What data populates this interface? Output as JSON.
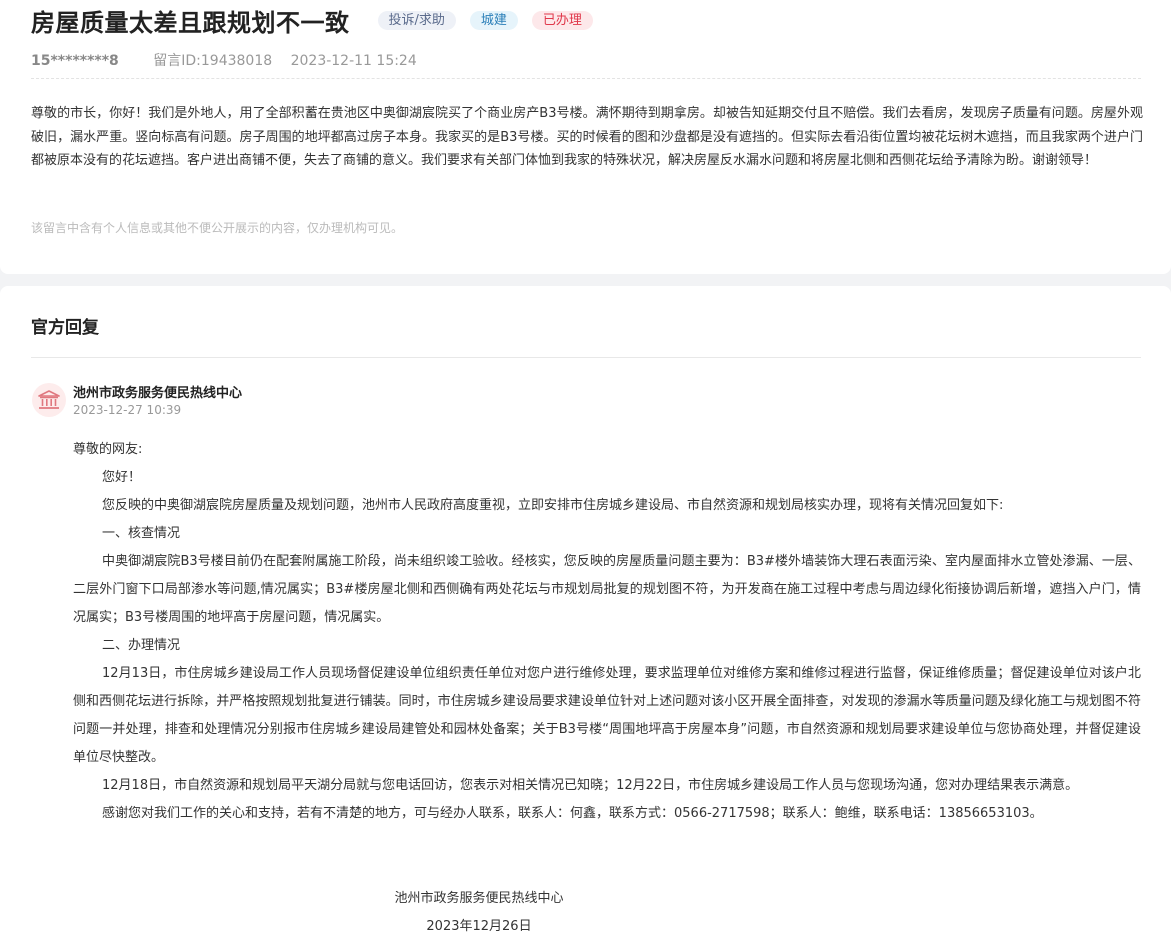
{
  "message": {
    "title": "房屋质量太差且跟规划不一致",
    "tags": {
      "type": "投诉/求助",
      "department": "城建",
      "status": "已办理"
    },
    "user_id": "15********8",
    "message_id_label": "留言ID:19438018",
    "datetime": "2023-12-11 15:24",
    "content": "尊敬的市长，你好！我们是外地人，用了全部积蓄在贵池区中奥御湖宸院买了个商业房产B3号楼。满怀期待到期拿房。却被告知延期交付且不赔偿。我们去看房，发现房子质量有问题。房屋外观破旧，漏水严重。竖向标高有问题。房子周围的地坪都高过房子本身。我家买的是B3号楼。买的时候看的图和沙盘都是没有遮挡的。但实际去看沿街位置均被花坛树木遮挡，而且我家两个进户门都被原本没有的花坛遮挡。客户进出商铺不便，失去了商铺的意义。我们要求有关部门体恤到我家的特殊状况，解决房屋反水漏水问题和将房屋北侧和西侧花坛给予清除为盼。谢谢领导！",
    "privacy_note": "该留言中含有个人信息或其他不便公开展示的内容，仅办理机构可见。"
  },
  "reply": {
    "heading": "官方回复",
    "avatar_icon": "government-building-icon",
    "org_name": "池州市政务服务便民热线中心",
    "datetime": "2023-12-27 10:39",
    "greeting": "尊敬的网友:",
    "paragraphs": [
      "您好！",
      "您反映的中奥御湖宸院房屋质量及规划问题，池州市人民政府高度重视，立即安排市住房城乡建设局、市自然资源和规划局核实办理，现将有关情况回复如下:",
      "一、核查情况",
      "中奥御湖宸院B3号楼目前仍在配套附属施工阶段，尚未组织竣工验收。经核实，您反映的房屋质量问题主要为：B3#楼外墙装饰大理石表面污染、室内屋面排水立管处渗漏、一层、二层外门窗下口局部渗水等问题,情况属实；B3#楼房屋北侧和西侧确有两处花坛与市规划局批复的规划图不符，为开发商在施工过程中考虑与周边绿化衔接协调后新增，遮挡入户门，情况属实；B3号楼周围的地坪高于房屋问题，情况属实。",
      "二、办理情况",
      "12月13日，市住房城乡建设局工作人员现场督促建设单位组织责任单位对您户进行维修处理，要求监理单位对维修方案和维修过程进行监督，保证维修质量；督促建设单位对该户北侧和西侧花坛进行拆除，并严格按照规划批复进行铺装。同时，市住房城乡建设局要求建设单位针对上述问题对该小区开展全面排查，对发现的渗漏水等质量问题及绿化施工与规划图不符问题一并处理，排查和处理情况分别报市住房城乡建设局建管处和园林处备案；关于B3号楼“周围地坪高于房屋本身”问题，市自然资源和规划局要求建设单位与您协商处理，并督促建设单位尽快整改。",
      "12月18日，市自然资源和规划局平天湖分局就与您电话回访，您表示对相关情况已知晓；12月22日，市住房城乡建设局工作人员与您现场沟通，您对办理结果表示满意。",
      "感谢您对我们工作的关心和支持，若有不清楚的地方，可与经办人联系，联系人：何鑫，联系方式：0566-2717598；联系人：鲍维，联系电话：13856653103。"
    ],
    "signature_org": "池州市政务服务便民热线中心",
    "signature_date": "2023年12月26日"
  }
}
